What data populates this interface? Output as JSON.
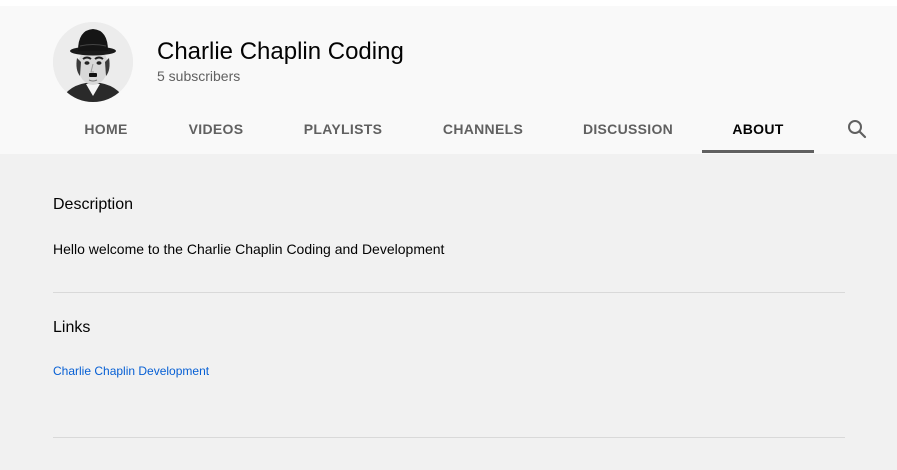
{
  "channel": {
    "name": "Charlie Chaplin Coding",
    "subscribers": "5 subscribers"
  },
  "tabs": [
    {
      "label": "HOME",
      "active": false
    },
    {
      "label": "VIDEOS",
      "active": false
    },
    {
      "label": "PLAYLISTS",
      "active": false
    },
    {
      "label": "CHANNELS",
      "active": false
    },
    {
      "label": "DISCUSSION",
      "active": false
    },
    {
      "label": "ABOUT",
      "active": true
    }
  ],
  "search": {
    "icon": "search-icon"
  },
  "about": {
    "description_title": "Description",
    "description_text": "Hello welcome to the Charlie Chaplin Coding and Development",
    "links_title": "Links",
    "links": [
      {
        "label": "Charlie Chaplin Development"
      }
    ]
  },
  "colors": {
    "header_bg": "#f9f9f9",
    "content_bg": "#f1f1f1",
    "link": "#065fd4",
    "active_tab_underline": "#606060"
  }
}
